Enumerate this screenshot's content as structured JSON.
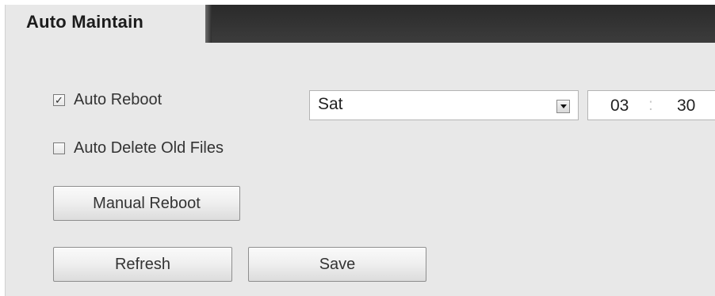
{
  "tab": {
    "title": "Auto Maintain"
  },
  "auto_reboot": {
    "checked": true,
    "label": "Auto Reboot",
    "day": "Sat",
    "hour": "03",
    "separator": ":",
    "minute": "30"
  },
  "auto_delete": {
    "checked": false,
    "label": "Auto Delete Old Files"
  },
  "buttons": {
    "manual_reboot": "Manual Reboot",
    "refresh": "Refresh",
    "save": "Save"
  },
  "icons": {
    "checkbox_checked": "check-mark",
    "dropdown": "chevron-down-icon"
  }
}
